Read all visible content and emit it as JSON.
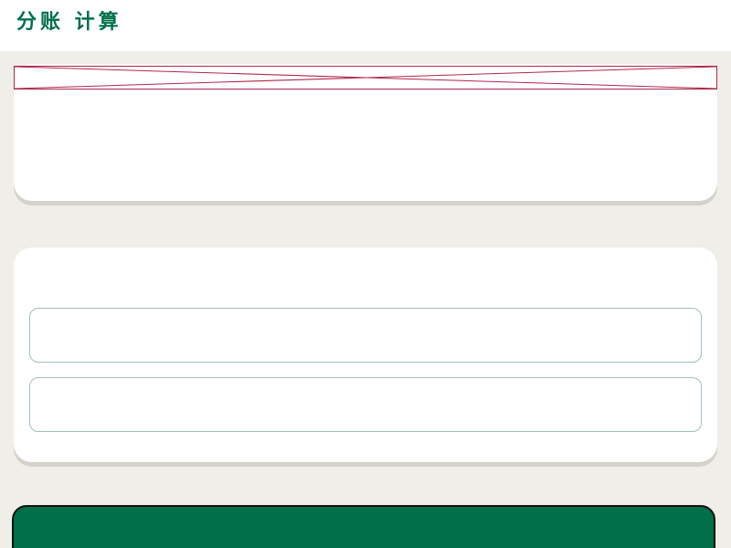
{
  "header": {
    "title": "分账 计算"
  },
  "summary": {
    "banner_text": "",
    "total_label": "",
    "total_value": ""
  },
  "split": {
    "title": "",
    "rows": [
      {
        "name": "",
        "amount": ""
      },
      {
        "name": "",
        "amount": ""
      }
    ]
  },
  "action": {
    "label": ""
  },
  "colors": {
    "brand": "#00704a",
    "background": "#f0eee9",
    "muted": "#a7c4b6",
    "banner_border": "#b0274a"
  }
}
